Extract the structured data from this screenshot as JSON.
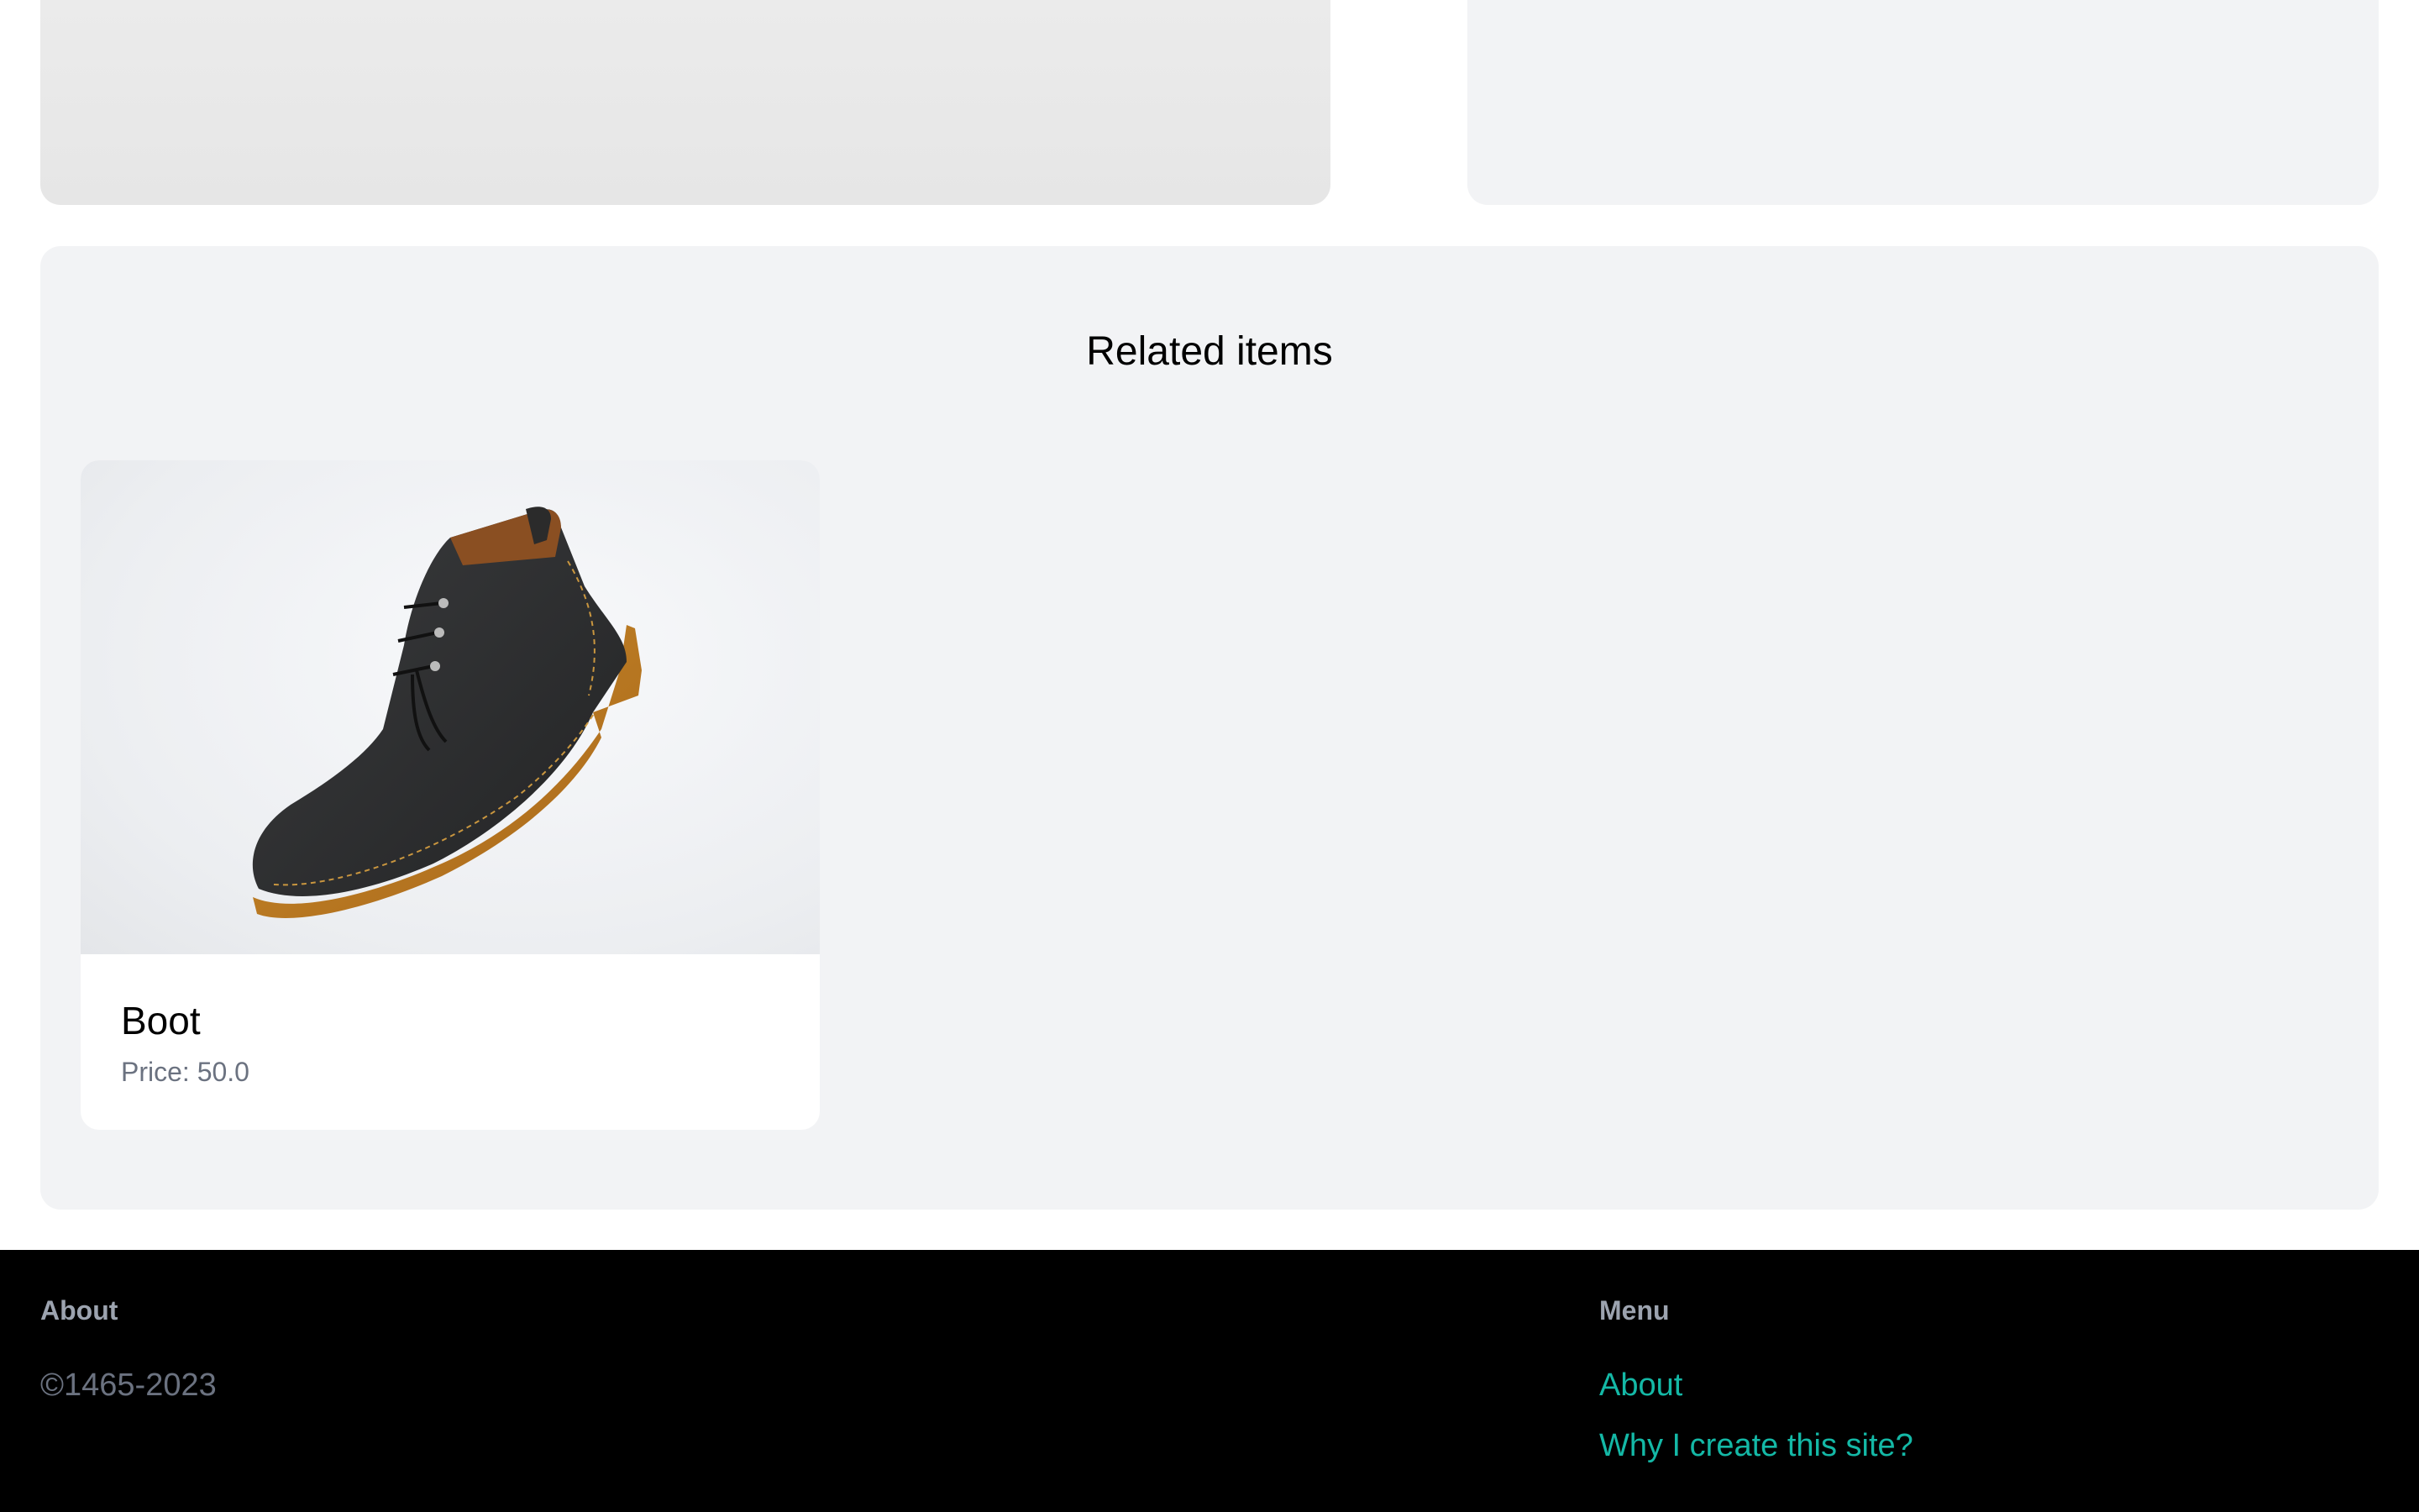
{
  "related": {
    "title": "Related items",
    "items": [
      {
        "name": "Boot",
        "price": "Price: 50.0",
        "image": "boot-photo"
      }
    ]
  },
  "footer": {
    "about_heading": "About",
    "copyright": "©1465-2023",
    "menu_heading": "Menu",
    "links": [
      {
        "label": "About"
      },
      {
        "label": "Why I create this site?"
      }
    ],
    "link_color": "#14b8a6",
    "background": "#000000"
  },
  "colors": {
    "section_background": "#f2f3f5",
    "muted_text": "#6b7280"
  }
}
